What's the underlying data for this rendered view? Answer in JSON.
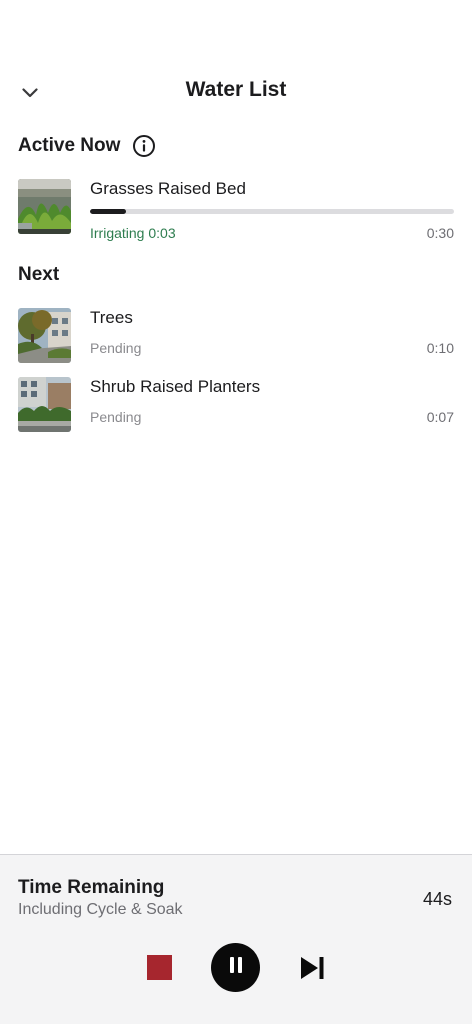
{
  "header": {
    "title": "Water List",
    "back_icon": "chevron-down-icon"
  },
  "active_section": {
    "title": "Active Now",
    "info_icon": "info-icon",
    "zone": {
      "name": "Grasses Raised Bed",
      "status": "Irrigating 0:03",
      "duration": "0:30",
      "progress": 0.1,
      "status_color": "#2e7d4f"
    }
  },
  "next_section": {
    "title": "Next",
    "zones": [
      {
        "name": "Trees",
        "status": "Pending",
        "duration": "0:10"
      },
      {
        "name": "Shrub Raised Planters",
        "status": "Pending",
        "duration": "0:07"
      }
    ]
  },
  "footer": {
    "title": "Time Remaining",
    "subtitle": "Including Cycle & Soak",
    "value": "44s",
    "stop_icon": "stop-icon",
    "pause_icon": "pause-icon",
    "skip_icon": "skip-next-icon",
    "stop_color": "#a6262e"
  }
}
